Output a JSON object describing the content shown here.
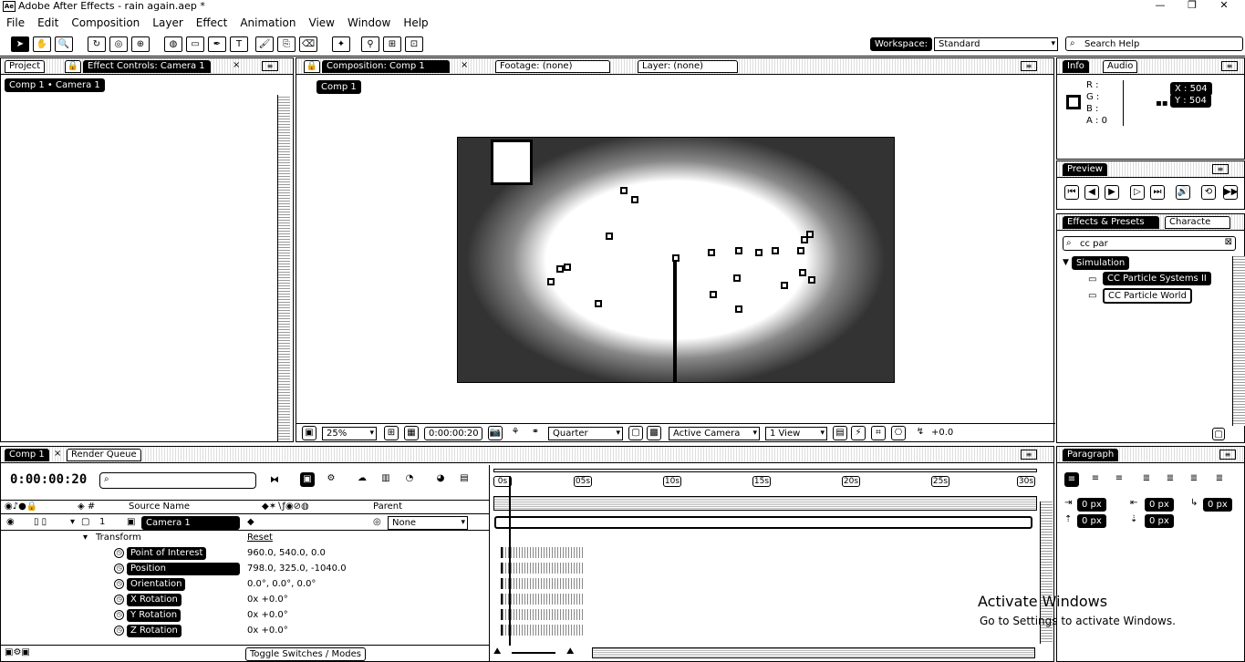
{
  "window": {
    "app_icon": "Ae",
    "title": "Adobe After Effects - rain again.aep *",
    "minimize": "—",
    "restore": "❐",
    "close": "✕"
  },
  "menu": [
    "File",
    "Edit",
    "Composition",
    "Layer",
    "Effect",
    "Animation",
    "View",
    "Window",
    "Help"
  ],
  "toolbar": {
    "workspace_label": "Workspace:",
    "workspace_value": "Standard",
    "search_placeholder": "Search Help"
  },
  "project_panel": {
    "tab_project": "Project",
    "tab_effect_controls": "Effect Controls: Camera 1",
    "breadcrumb": "Comp 1 • Camera 1"
  },
  "composition_panel": {
    "tab_composition": "Composition: Comp 1",
    "tab_footage": "Footage: (none)",
    "tab_layer": "Layer: (none)",
    "comp_button": "Comp 1",
    "zoom": "25%",
    "timecode": "0:00:00:20",
    "resolution": "Quarter",
    "camera": "Active Camera",
    "views": "1 View",
    "exposure": "+0.0"
  },
  "info_panel": {
    "tab_info": "Info",
    "tab_audio": "Audio",
    "r_label": "R :",
    "g_label": "G :",
    "b_label": "B :",
    "a_label": "A : 0",
    "x_label": "X : 504",
    "y_label": "Y : 504"
  },
  "preview_panel": {
    "tab": "Preview"
  },
  "effects_panel": {
    "tab_effects": "Effects & Presets",
    "tab_character": "Characte",
    "search_value": "cc par",
    "category": "Simulation",
    "items": [
      "CC Particle Systems II",
      "CC Particle World"
    ]
  },
  "timeline": {
    "tab_comp": "Comp 1",
    "tab_render": "Render Queue",
    "timecode": "0:00:00:20",
    "col_source": "Source Name",
    "col_parent": "Parent",
    "layer_num": "1",
    "layer_name": "Camera 1",
    "parent_value": "None",
    "transform_label": "Transform",
    "reset_label": "Reset",
    "properties": [
      {
        "name": "Point of Interest",
        "value": "960.0, 540.0, 0.0"
      },
      {
        "name": "Position",
        "value": "798.0, 325.0, -1040.0"
      },
      {
        "name": "Orientation",
        "value": "0.0°, 0.0°, 0.0°"
      },
      {
        "name": "X Rotation",
        "value": "0x +0.0°"
      },
      {
        "name": "Y Rotation",
        "value": "0x +0.0°"
      },
      {
        "name": "Z Rotation",
        "value": "0x +0.0°"
      }
    ],
    "ruler": [
      "0s",
      "05s",
      "10s",
      "15s",
      "20s",
      "25s",
      "30s"
    ],
    "toggle_label": "Toggle Switches / Modes"
  },
  "paragraph_panel": {
    "tab": "Paragraph",
    "indent_values": [
      "0 px",
      "0 px",
      "0 px",
      "0 px",
      "0 px"
    ]
  },
  "watermark": {
    "line1": "Activate Windows",
    "line2": "Go to Settings to activate Windows."
  }
}
